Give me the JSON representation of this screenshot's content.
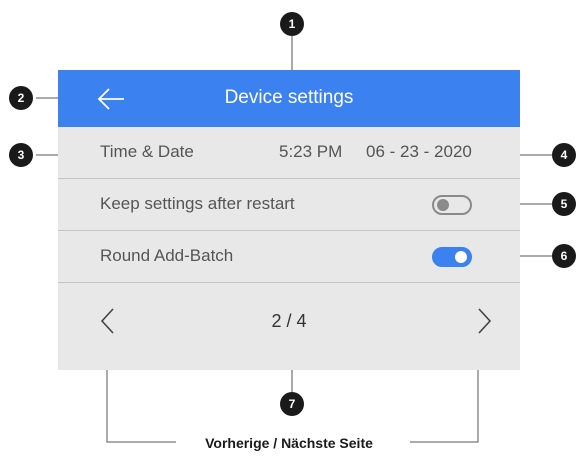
{
  "header": {
    "title": "Device settings",
    "back_icon": "arrow-left-icon"
  },
  "rows": [
    {
      "label": "Time & Date",
      "time": "5:23 PM",
      "date": "06 - 23 - 2020"
    },
    {
      "label": "Keep settings after restart",
      "toggle": false
    },
    {
      "label": "Round Add-Batch",
      "toggle": true
    }
  ],
  "pager": {
    "current": "2 / 4",
    "prev_icon": "chevron-left-icon",
    "next_icon": "chevron-right-icon"
  },
  "callouts": [
    "1",
    "2",
    "3",
    "4",
    "5",
    "6",
    "7"
  ],
  "caption": "Vorherige / Nächste Seite",
  "colors": {
    "accent": "#3b82f0",
    "panel": "#e8e8e8",
    "callout": "#1a1a1a"
  }
}
